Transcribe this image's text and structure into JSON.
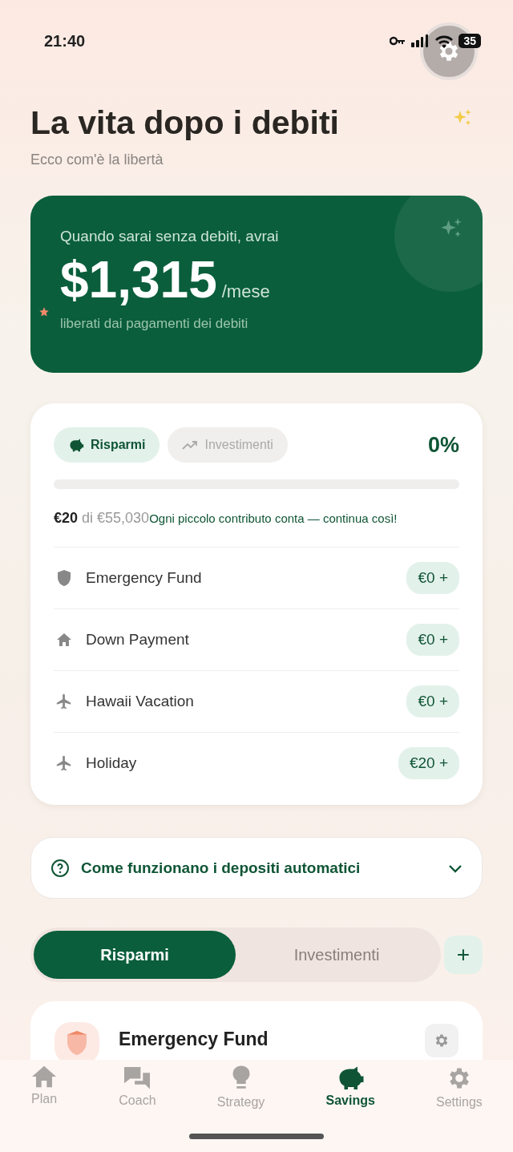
{
  "status_bar": {
    "time": "21:40",
    "battery": "35"
  },
  "header": {
    "title": "La vita dopo i debiti",
    "subtitle": "Ecco com'è la libertà"
  },
  "hero": {
    "intro": "Quando sarai senza debiti, avrai",
    "amount": "$1,315",
    "unit": "/mese",
    "caption": "liberati dai pagamenti dei debiti"
  },
  "savings_card": {
    "tabs": [
      {
        "label": "Risparmi",
        "kind": "savings",
        "selected": true
      },
      {
        "label": "Investimenti",
        "kind": "investments",
        "selected": false
      }
    ],
    "percent": "0%",
    "progress_text": "**€20** di €55,030",
    "message": "Ogni piccolo contributo conta — continua così!",
    "goals": [
      {
        "kind": "emergency",
        "name": "Emergency Fund",
        "amount": "€0 +"
      },
      {
        "kind": "housing",
        "name": "Down Payment",
        "amount": "€0 +"
      },
      {
        "kind": "travel",
        "name": "Hawaii Vacation",
        "amount": "€0 +"
      },
      {
        "kind": "travel",
        "name": "Holiday",
        "amount": "€20 +"
      }
    ]
  },
  "faq": {
    "label": "Come funzionano i depositi automatici",
    "expanded": false
  },
  "segment": {
    "options": [
      {
        "label": "Risparmi",
        "selected": true
      },
      {
        "label": "Investimenti",
        "selected": false
      }
    ],
    "add": "+"
  },
  "goal_card": {
    "title": "Emergency Fund"
  },
  "nav": [
    {
      "label": "Plan",
      "kind": "plan",
      "selected": false
    },
    {
      "label": "Coach",
      "kind": "coach",
      "selected": false
    },
    {
      "label": "Strategy",
      "kind": "strategy",
      "selected": false
    },
    {
      "label": "Savings",
      "kind": "savings",
      "selected": true
    },
    {
      "label": "Settings",
      "kind": "settings",
      "selected": false
    }
  ]
}
